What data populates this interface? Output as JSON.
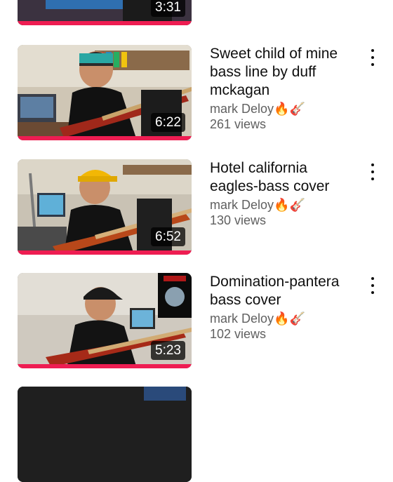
{
  "videos": [
    {
      "title": "",
      "channel": "",
      "emoji": "",
      "views": "",
      "duration": "3:31",
      "progress": 1.0
    },
    {
      "title": "Sweet child of mine bass line by duff mckagan",
      "channel": "mark Deloy",
      "emoji": "🔥🎸",
      "views": "261 views",
      "duration": "6:22",
      "progress": 1.0
    },
    {
      "title": "Hotel california eagles-bass cover",
      "channel": "mark Deloy",
      "emoji": "🔥🎸",
      "views": "130 views",
      "duration": "6:52",
      "progress": 1.0
    },
    {
      "title": "Domination-pantera bass cover",
      "channel": "mark Deloy",
      "emoji": "🔥🎸",
      "views": "102 views",
      "duration": "5:23",
      "progress": 1.0
    },
    {
      "title": "",
      "channel": "",
      "emoji": "",
      "views": "",
      "duration": "",
      "progress": 0
    }
  ],
  "colors": {
    "progress_bar": "#ee1d52",
    "secondary_text": "#606060",
    "primary_text": "#0f0f0f"
  },
  "icons": {
    "more": "more-vert-icon"
  }
}
